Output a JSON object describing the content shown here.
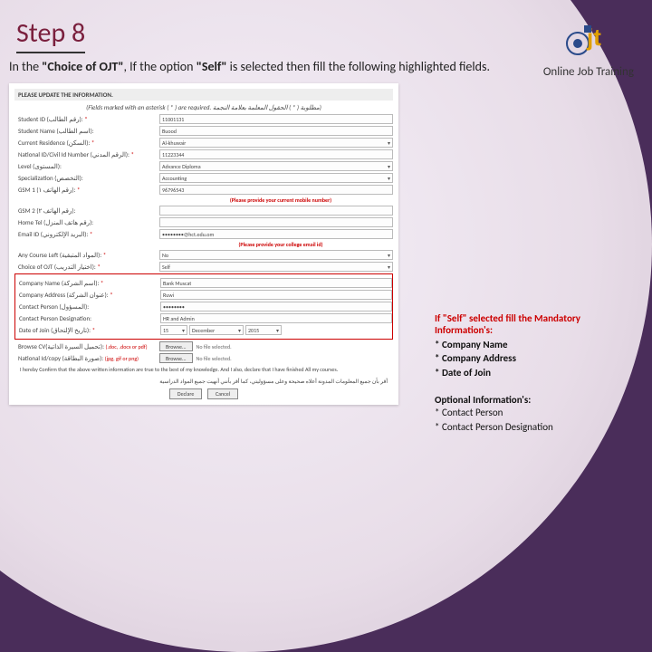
{
  "title": "Step 8",
  "subtitle_pre": "In the ",
  "subtitle_bold1": "\"Choice of OJT\"",
  "subtitle_mid": ", If the option ",
  "subtitle_bold2": "\"Self\"",
  "subtitle_post": " is selected then fill the following highlighted fields.",
  "logo_text": "Online Job Training",
  "form": {
    "header": "PLEASE UPDATE THE INFORMATION.",
    "asterisk_note": "(Fields marked with an asterisk ( * ) are required.  مطلوبة ( * ) الحقول المعلمة بعلامة النجمة)",
    "rows": {
      "student_id_lbl": "Student ID (رقم الطالب):",
      "student_id_val": "11001131",
      "name_lbl": "Student Name (اسم الطالب):",
      "name_val": "Buood",
      "residence_lbl": "Current Residence (السكن):",
      "residence_val": "Al-khuwair",
      "natid_lbl": "National ID/Civil Id Number (الرقم المدني):",
      "natid_val": "11223344",
      "level_lbl": "Level (المستوى):",
      "level_val": "Advance Diploma",
      "spec_lbl": "Specialization (التخصص):",
      "spec_val": "Accounting",
      "gsm1_lbl": "GSM 1 (رقم الهاتف ١):",
      "gsm1_val": "96796543",
      "hint1": "(Please provide your current mobile number)",
      "gsm2_lbl": "GSM 2 (رقم الهاتف ٢):",
      "home_lbl": "Home Tel (رقم هاتف المنزل):",
      "email_lbl": "Email ID (البريد الإلكتروني):",
      "email_val": "••••••••@hct.edu.om",
      "hint2": "(Please provide your college email id)",
      "course_lbl": "Any Course Left (المواد المتبقية):",
      "course_val": "No",
      "choice_lbl": "Choice of OJT (اختيار التدريب):",
      "choice_val": "Self",
      "company_lbl": "Company Name (اسم الشركة):",
      "company_val": "Bank Muscat",
      "addr_lbl": "Company Address (عنوان الشركة):",
      "addr_val": "Ruwi",
      "contact_lbl": "Contact Person (المسؤول):",
      "contact_val": "••••••••",
      "desig_lbl": "Contact Person Designation:",
      "desig_val": "HR and Admin",
      "doj_lbl": "Date of Join (تاريخ الإلتحاق):",
      "doj_d": "15",
      "doj_m": "December",
      "doj_y": "2015",
      "cv_lbl": "Browse CV(تحميل السيرة الذاتية):",
      "cv_ext": "(.doc, .docx or pdf)",
      "browse": "Browse...",
      "nofile": "No file selected.",
      "natid2_lbl": "National Id/copy (صورة البطاقة):",
      "natid2_ext": "(jpg, gif or png)"
    },
    "declare": "I hereby Confirm that the above written information are true to the best of my knowledge. And I also, declare that I have finished All my courses.",
    "arabic": "أقر بأن جميع المعلومات المدونة أعلاه صحيحة وعلى مسؤوليتي، كما أقر بأنني أنهيت جميع المواد الدراسية",
    "btn1": "Declare",
    "btn2": "Cancel"
  },
  "callout1": {
    "head": "If \"Self\" selected fill the Mandatory Information's:",
    "l1": "* Company Name",
    "l2": "* Company Address",
    "l3": "* Date of Join"
  },
  "callout2": {
    "head": "Optional Information's:",
    "l1": "* Contact Person",
    "l2": "* Contact Person Designation"
  }
}
